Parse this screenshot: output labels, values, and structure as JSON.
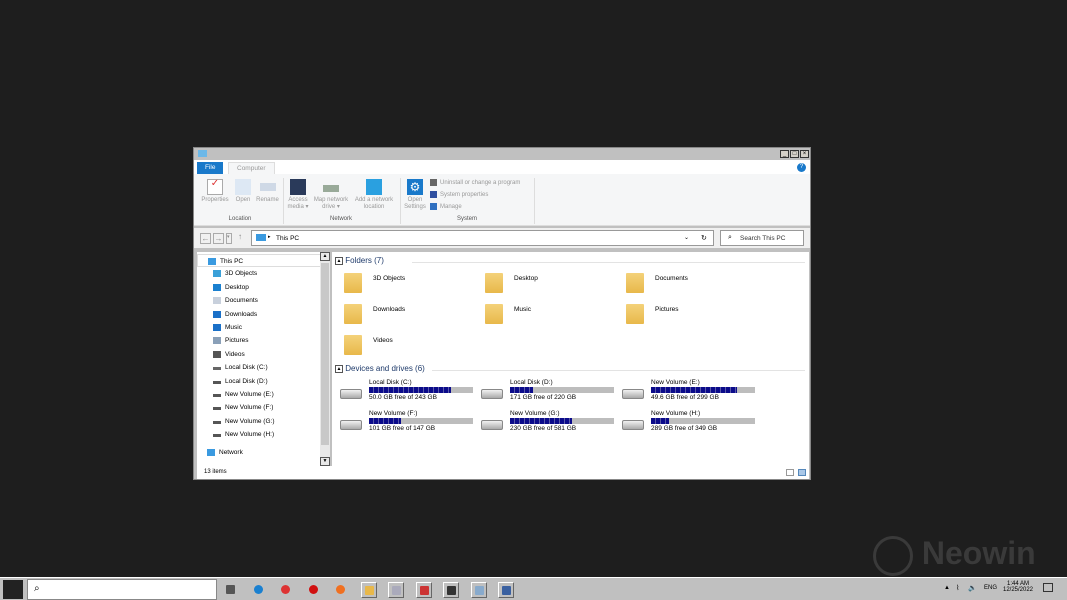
{
  "window": {
    "controls": [
      "_",
      "□",
      "×"
    ],
    "help": "?"
  },
  "tabs": [
    {
      "label": "File",
      "active": true
    },
    {
      "label": "Computer"
    }
  ],
  "ribbon": {
    "location": {
      "label": "Location",
      "buttons": [
        "Properties",
        "Open",
        "Rename"
      ]
    },
    "network": {
      "label": "Network",
      "buttons": [
        "Access media ▾",
        "Map network drive ▾",
        "Add a network location"
      ]
    },
    "system": {
      "label": "System",
      "open_settings": "Open Settings",
      "items": [
        "Uninstall or change a program",
        "System properties",
        "Manage"
      ]
    }
  },
  "address": {
    "path": "This PC",
    "search_placeholder": "Search This PC"
  },
  "nav": {
    "items": [
      "This PC",
      "3D Objects",
      "Desktop",
      "Documents",
      "Downloads",
      "Music",
      "Pictures",
      "Videos",
      "Local Disk (C:)",
      "Local Disk (D:)",
      "New Volume (E:)",
      "New Volume (F:)",
      "New Volume (G:)",
      "New Volume (H:)"
    ],
    "network": "Network"
  },
  "folders": {
    "header": "Folders (7)",
    "items": [
      "3D Objects",
      "Desktop",
      "Documents",
      "Downloads",
      "Music",
      "Pictures",
      "Videos"
    ]
  },
  "drives": {
    "header": "Devices and drives (6)",
    "items": [
      {
        "name": "Local Disk (C:)",
        "space": "50.0 GB free of 243 GB",
        "used_fraction": 0.79
      },
      {
        "name": "Local Disk (D:)",
        "space": "171 GB free of 220 GB",
        "used_fraction": 0.22
      },
      {
        "name": "New Volume (E:)",
        "space": "49.6 GB free of 299 GB",
        "used_fraction": 0.83
      },
      {
        "name": "New Volume (F:)",
        "space": "101 GB free of 147 GB",
        "used_fraction": 0.31
      },
      {
        "name": "New Volume (G:)",
        "space": "230 GB free of 581 GB",
        "used_fraction": 0.6
      },
      {
        "name": "New Volume (H:)",
        "space": "289 GB free of 349 GB",
        "used_fraction": 0.17
      }
    ]
  },
  "status": {
    "items": "13 items"
  },
  "taskbar": {
    "apps": [
      "task-view",
      "edge",
      "chrome",
      "opera",
      "firefox",
      "file-explorer",
      "explorer-window",
      "paint3d",
      "settings",
      "notepad",
      "app"
    ],
    "lang": "ENG",
    "time": "1:44 AM",
    "date": "12/25/2022"
  },
  "watermark": "Neowin"
}
